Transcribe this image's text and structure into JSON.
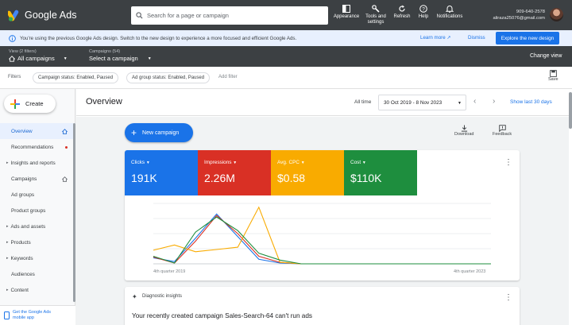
{
  "app": {
    "title": "Google Ads"
  },
  "search": {
    "placeholder": "Search for a page or campaign"
  },
  "toolbar": {
    "appearance": "Appearance",
    "tools_line1": "Tools and",
    "tools_line2": "settings",
    "refresh": "Refresh",
    "help": "Help",
    "notifications": "Notifications"
  },
  "account": {
    "phone": "909-640-2578",
    "email": "aliraza25076@gmail.com"
  },
  "banner": {
    "text": "You're using the previous Google Ads design. Switch to the new design to experience a more focused and efficient Google Ads.",
    "learn_more": "Learn more",
    "dismiss": "Dismiss",
    "explore": "Explore the new design"
  },
  "selectors": {
    "view_caption": "View (2 filters)",
    "view_value": "All campaigns",
    "campaigns_caption": "Campaigns (54)",
    "campaigns_value": "Select a campaign",
    "change_view": "Change view"
  },
  "filters": {
    "label": "Filters",
    "chips": [
      "Campaign status: Enabled, Paused",
      "Ad group status: Enabled, Paused"
    ],
    "add_filter": "Add filter",
    "save": "Save"
  },
  "sidebar": {
    "create": "Create",
    "items": [
      {
        "label": "Overview"
      },
      {
        "label": "Recommendations"
      },
      {
        "label": "Insights and reports"
      },
      {
        "label": "Campaigns"
      },
      {
        "label": "Ad groups"
      },
      {
        "label": "Product groups"
      },
      {
        "label": "Ads and assets"
      },
      {
        "label": "Products"
      },
      {
        "label": "Keywords"
      },
      {
        "label": "Audiences"
      },
      {
        "label": "Content"
      }
    ],
    "mobile_line1": "Get the Google Ads",
    "mobile_line2": "mobile app"
  },
  "main": {
    "title": "Overview",
    "all_time": "All time",
    "date_range": "30 Oct 2019 - 8 Nov 2023",
    "show_last": "Show last 30 days",
    "new_campaign": "New campaign",
    "download": "Download",
    "feedback": "Feedback"
  },
  "colors": {
    "clicks": "#1a73e8",
    "impressions": "#d93025",
    "avg_cpc": "#f9ab00",
    "cost": "#1e8e3e"
  },
  "chart_data": {
    "type": "line",
    "x": [
      "4th quarter 2019",
      "",
      "",
      "",
      "",
      "",
      "",
      "",
      "",
      "",
      "",
      "",
      "",
      "",
      "",
      "",
      "4th quarter 2023"
    ],
    "series": [
      {
        "name": "Clicks",
        "display_value": "191K",
        "color": "#1a73e8",
        "values": [
          8,
          3,
          34,
          66,
          36,
          6,
          1,
          0,
          0,
          0,
          0,
          0,
          0,
          0,
          0,
          0,
          0
        ]
      },
      {
        "name": "Impressions",
        "display_value": "2.26M",
        "color": "#d93025",
        "values": [
          9,
          1,
          30,
          64,
          40,
          10,
          2,
          0,
          0,
          0,
          0,
          0,
          0,
          0,
          0,
          0,
          0
        ]
      },
      {
        "name": "Avg. CPC",
        "display_value": "$0.58",
        "color": "#f9ab00",
        "values": [
          18,
          25,
          16,
          19,
          22,
          75,
          2,
          0,
          0,
          0,
          0,
          0,
          0,
          0,
          0,
          0,
          0
        ]
      },
      {
        "name": "Cost",
        "display_value": "$110K",
        "color": "#1e8e3e",
        "values": [
          10,
          1,
          42,
          62,
          44,
          14,
          5,
          0,
          0,
          0,
          0,
          0,
          0,
          0,
          0,
          0,
          0
        ]
      }
    ],
    "ylim": [
      0,
      80
    ],
    "grid": true
  },
  "insights": {
    "title": "Diagnostic insights",
    "message": "Your recently created campaign Sales-Search-64 can't run ads"
  }
}
